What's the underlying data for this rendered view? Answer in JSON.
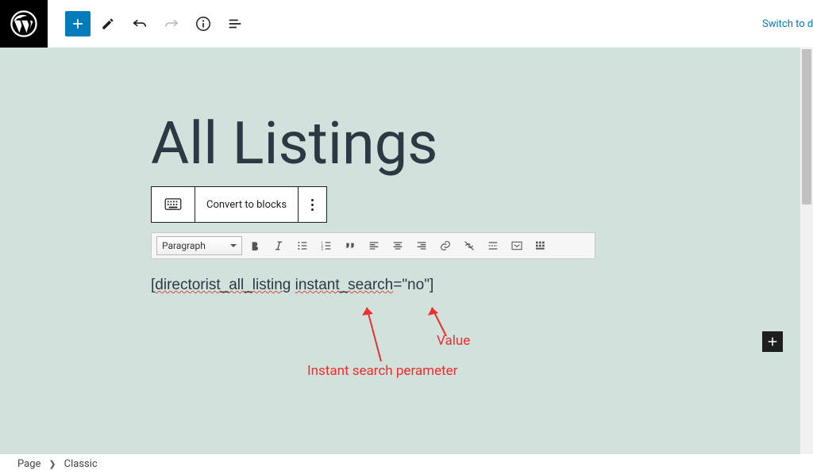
{
  "header": {
    "switch_link": "Switch to draft"
  },
  "page": {
    "title": "All Listings"
  },
  "classic_toolbar": {
    "convert_label": "Convert to blocks"
  },
  "tinymce": {
    "format_select": "Paragraph"
  },
  "shortcode": {
    "bracket_open": "[",
    "tag": "directorist_all_listing",
    "param": "instant_search",
    "eq": "=\"no\"]"
  },
  "annotations": {
    "param_label": "Instant search perameter",
    "value_label": "Value"
  },
  "breadcrumb": {
    "root": "Page",
    "current": "Classic"
  }
}
